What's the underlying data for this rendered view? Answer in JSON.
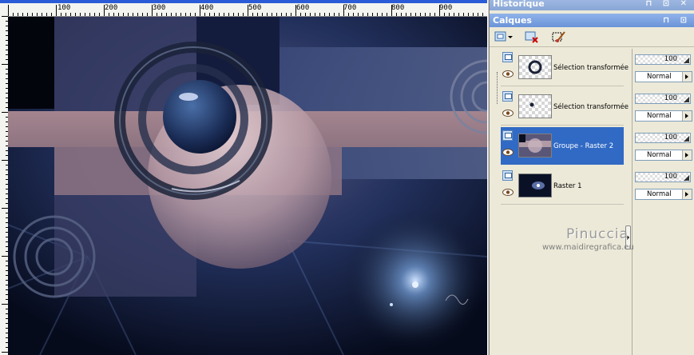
{
  "ruler": {
    "labels": [
      "100",
      "200",
      "300",
      "400",
      "500",
      "600",
      "700",
      "800",
      "900"
    ]
  },
  "panels": {
    "history_title": "Historique",
    "layers_title": "Calques"
  },
  "layers": [
    {
      "name": "Sélection transformée",
      "opacity": "100",
      "blend": "Normal",
      "selected": false
    },
    {
      "name": "Sélection transformée",
      "opacity": "100",
      "blend": "Normal",
      "selected": false
    },
    {
      "name": "Groupe - Raster 2",
      "opacity": "100",
      "blend": "Normal",
      "selected": true
    },
    {
      "name": "Raster 1",
      "opacity": "100",
      "blend": "Normal",
      "selected": false
    }
  ],
  "watermark": {
    "name": "Pinuccia",
    "url": "www.maidiregrafica.eu"
  },
  "colors": {
    "selection": "#316ac5",
    "titlebar": "#7ea2e0",
    "panel": "#ece9d8"
  }
}
